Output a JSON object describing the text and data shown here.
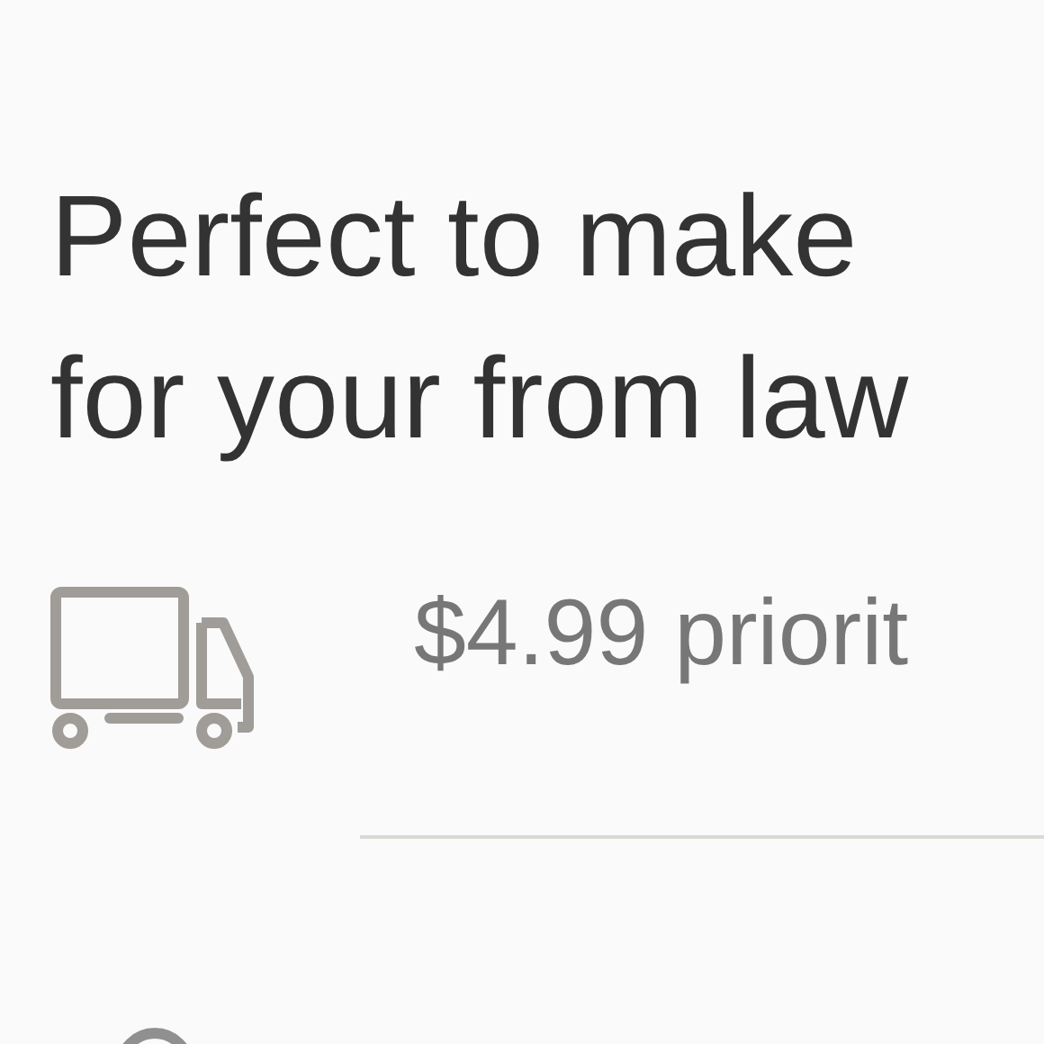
{
  "description": {
    "lines": [
      "Perfect to make",
      "for your from law"
    ]
  },
  "shipping": {
    "text": "$4.99 priorit"
  }
}
